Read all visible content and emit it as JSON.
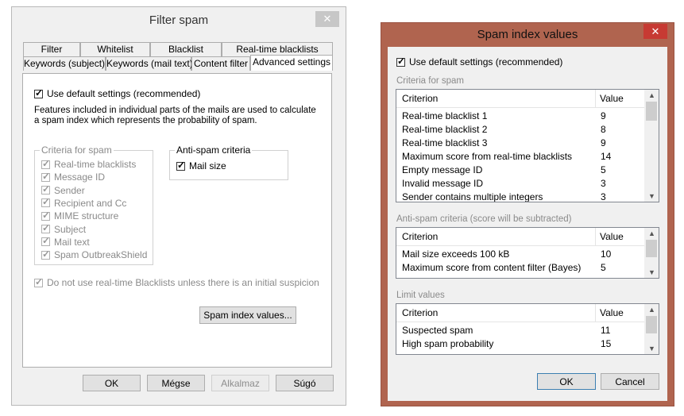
{
  "filter_window": {
    "title": "Filter spam",
    "close": "✕",
    "tabs_row1": [
      "Filter",
      "Whitelist",
      "Blacklist",
      "Real-time blacklists"
    ],
    "tabs_row2": [
      "Keywords (subject)",
      "Keywords (mail text)",
      "Content filter",
      "Advanced settings"
    ],
    "active_tab": "Advanced settings",
    "use_default_label": "Use default settings (recommended)",
    "description_line1": "Features included in individual parts of the mails are used to calculate",
    "description_line2": "a spam index which represents the probability of spam.",
    "criteria_label": "Criteria for spam",
    "criteria_items": [
      "Real-time blacklists",
      "Message ID",
      "Sender",
      "Recipient and Cc",
      "MIME structure",
      "Subject",
      "Mail text",
      "Spam OutbreakShield"
    ],
    "antispam_label": "Anti-spam criteria",
    "antispam_items": [
      "Mail size"
    ],
    "rtbl_option": "Do not use real-time Blacklists unless there is an initial suspicion",
    "spam_index_button": "Spam index values...",
    "buttons": {
      "ok": "OK",
      "cancel": "Mégse",
      "apply": "Alkalmaz",
      "help": "Súgó"
    }
  },
  "index_window": {
    "title": "Spam index values",
    "close": "✕",
    "use_default_label": "Use default settings (recommended)",
    "criteria_section": "Criteria for spam",
    "antispam_section": "Anti-spam criteria (score will be subtracted)",
    "limit_section": "Limit values",
    "col_criterion": "Criterion",
    "col_value": "Value",
    "criteria_rows": [
      {
        "name": "Real-time blacklist 1",
        "value": "9"
      },
      {
        "name": "Real-time blacklist 2",
        "value": "8"
      },
      {
        "name": "Real-time blacklist 3",
        "value": "9"
      },
      {
        "name": "Maximum score from real-time blacklists",
        "value": "14"
      },
      {
        "name": "Empty message ID",
        "value": "5"
      },
      {
        "name": "Invalid message ID",
        "value": "3"
      },
      {
        "name": "Sender contains multiple integers",
        "value": "3"
      }
    ],
    "antispam_rows": [
      {
        "name": "Mail size exceeds 100 kB",
        "value": "10"
      },
      {
        "name": "Maximum score from content filter (Bayes)",
        "value": "5"
      }
    ],
    "limit_rows": [
      {
        "name": "Suspected spam",
        "value": "11"
      },
      {
        "name": "High spam probability",
        "value": "15"
      }
    ],
    "buttons": {
      "ok": "OK",
      "cancel": "Cancel"
    }
  }
}
